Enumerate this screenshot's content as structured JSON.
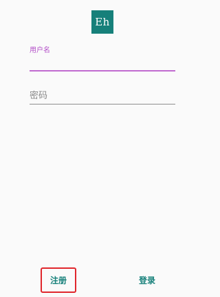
{
  "logo": {
    "text": "Eh"
  },
  "username": {
    "label": "用户名",
    "value": ""
  },
  "password": {
    "placeholder": "密码",
    "value": ""
  },
  "actions": {
    "register_label": "注册",
    "login_label": "登录"
  },
  "colors": {
    "accent": "#16807a",
    "focus_label": "#b34fc8",
    "highlight_box": "#e0262c"
  }
}
